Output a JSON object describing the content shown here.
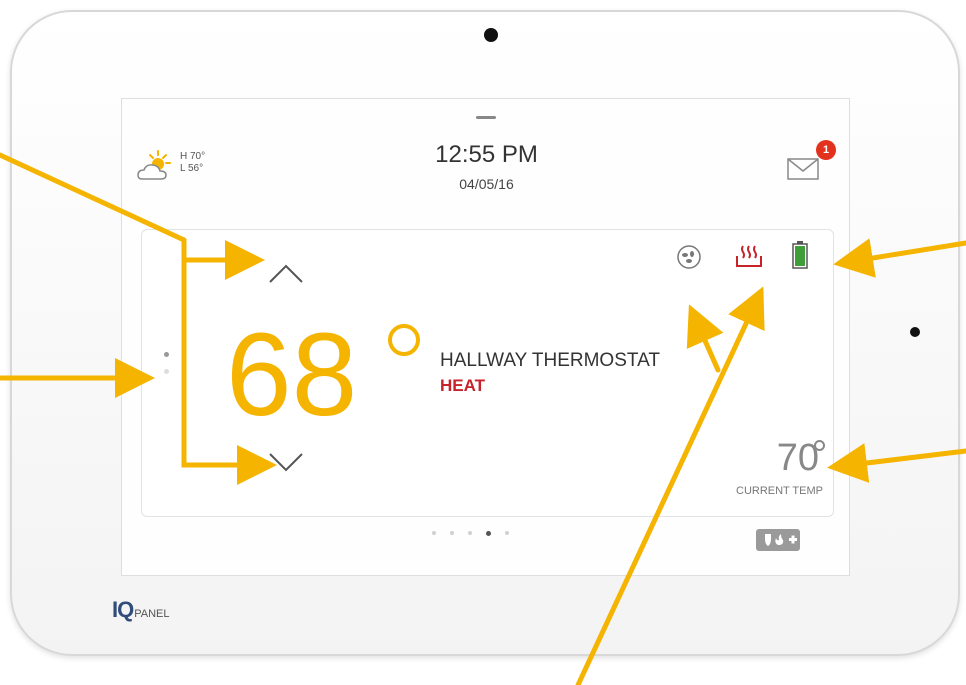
{
  "status_bar": {
    "weather": {
      "icon": "partly-sunny-icon",
      "high": "H 70°",
      "low": "L 56°"
    },
    "time": "12:55 PM",
    "date": "04/05/16",
    "messages": {
      "icon": "envelope-icon",
      "unread_count": "1"
    }
  },
  "thermostat": {
    "setpoint": "68",
    "name": "HALLWAY THERMOSTAT",
    "mode": "HEAT",
    "current_temp": "70",
    "current_label": "CURRENT TEMP",
    "status_icons": [
      "fan-icon",
      "heat-icon",
      "battery-icon"
    ]
  },
  "pager": {
    "total": 5,
    "active_index": 3
  },
  "brand": {
    "iq": "IQ",
    "panel": "PANEL"
  },
  "colors": {
    "accent": "#f5b400",
    "heat": "#c8232b",
    "battery": "#3f9d3a",
    "badge": "#e2321e"
  }
}
